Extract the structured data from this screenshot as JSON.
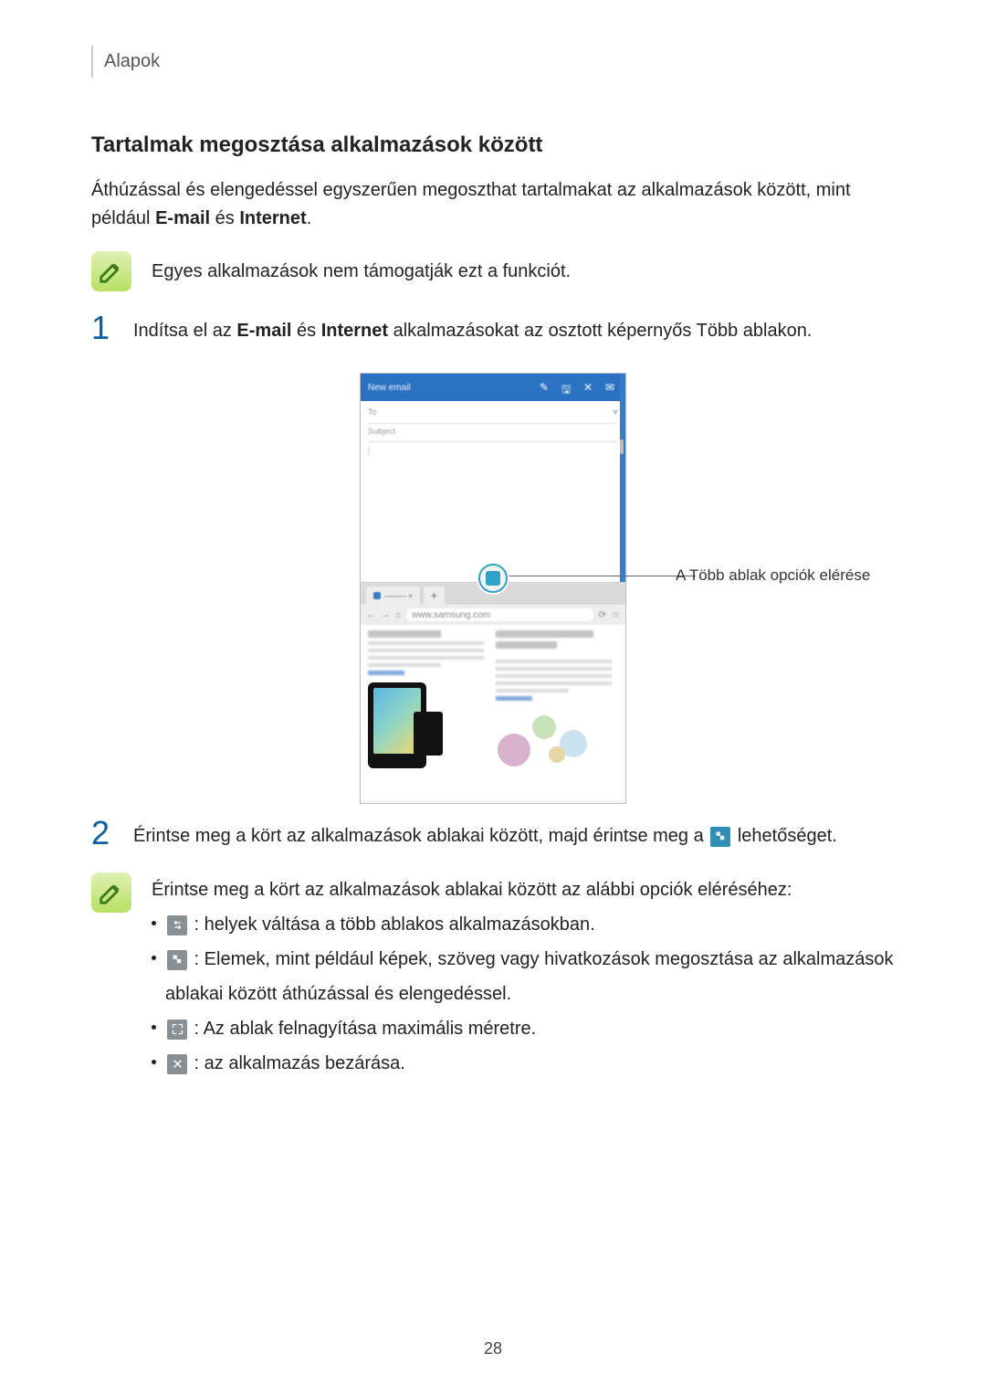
{
  "header": {
    "section": "Alapok"
  },
  "subtitle": "Tartalmak megosztása alkalmazások között",
  "intro": {
    "p1_a": "Áthúzással és elengedéssel egyszerűen megoszthat tartalmakat az alkalmazások között, mint például ",
    "email": "E-mail",
    "and": " és ",
    "internet": "Internet",
    "p1_b": "."
  },
  "note1": "Egyes alkalmazások nem támogatják ezt a funkciót.",
  "step1": {
    "num": "1",
    "a": "Indítsa el az ",
    "email": "E-mail",
    "mid": " és ",
    "internet": "Internet",
    "b": " alkalmazásokat az osztott képernyős Több ablakon."
  },
  "figure": {
    "callout": "A Több ablak opciók elérése",
    "topbar": "New email",
    "to": "To",
    "subject": "Subject",
    "cursor": "|",
    "url": "www.samsung.com"
  },
  "step2": {
    "num": "2",
    "a": "Érintse meg a kört az alkalmazások ablakai között, majd érintse meg a ",
    "b": " lehetőséget."
  },
  "note2": {
    "intro": "Érintse meg a kört az alkalmazások ablakai között az alábbi opciók eléréséhez:",
    "i1": " : helyek váltása a több ablakos alkalmazásokban.",
    "i2": " : Elemek, mint például képek, szöveg vagy hivatkozások megosztása az alkalmazások ablakai között áthúzással és elengedéssel.",
    "i3": " : Az ablak felnagyítása maximális méretre.",
    "i4": " : az alkalmazás bezárása."
  },
  "pagenum": "28"
}
